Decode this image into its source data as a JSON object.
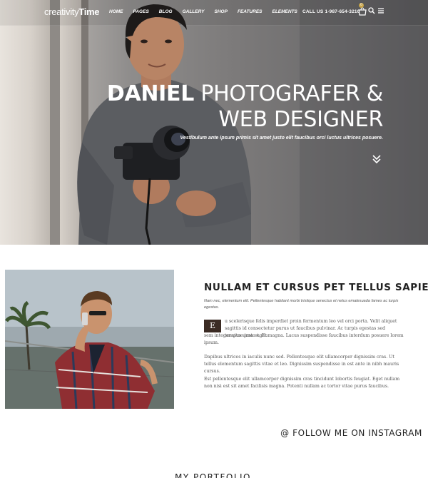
{
  "header": {
    "logo_light": "creativity",
    "logo_bold": "Time",
    "menu": [
      "HOME",
      "PAGES",
      "BLOG",
      "GALLERY",
      "SHOP",
      "FEATURES",
      "ELEMENTS"
    ],
    "contact": "CALL US 1-987-654-3210",
    "cart_count": "0",
    "icons": [
      "cart-icon",
      "search-icon",
      "menu-icon"
    ]
  },
  "hero": {
    "name": "DANIEL",
    "title_line1_rest": "PHOTOGRAFER &",
    "title_line2": "WEB DESIGNER",
    "subtitle": "Vestibulum ante ipsum primis sit amet justo elit faucibus orci luctus ultrices posuere.",
    "scroll_icon": "chevrons-down-icon"
  },
  "about": {
    "title": "NULLAM ET CURSUS PET TELLUS SAPIEN.",
    "lead": "Nam nec, elementum elit. Pellentesque habitant morbi tristique senectus et netus emalesuada fames ac turpis egestas.",
    "dropcap": "E",
    "p1_first": "u scelerisque felis imperdiet proin fermentum leo vel orci porta. Velit aliquet sagittis id consectetur purus ut faucibus pulvinar. Ac turpis egestas sed tempus urna et. Eu",
    "p1_rest": "sem integer vitae justo eget magna. Lacus suspendisse faucibus interdum posuere lorem ipsum.",
    "p2": "Dapibus ultrices in iaculis nunc sed. Pellentesque elit ullamcorper dignissim cras. Ut tellus elementum sagittis vitae et leo. Dignissim suspendisse in est ante in nibh mauris cursus.",
    "p3": "Est pellentesque elit ullamcorper dignissim cras tincidunt lobortis feugiat. Eget nullam non nisi est sit amet facilisis magna. Potenti nullam ac tortor vitae purus faucibus."
  },
  "instagram": {
    "label": "@ FOLLOW ME ON INSTAGRAM"
  },
  "portfolio": {
    "label": "MY PORTFOLIO"
  },
  "colors": {
    "dropcap_bg": "#3b2b24",
    "cart_badge": "#c7a44a"
  }
}
